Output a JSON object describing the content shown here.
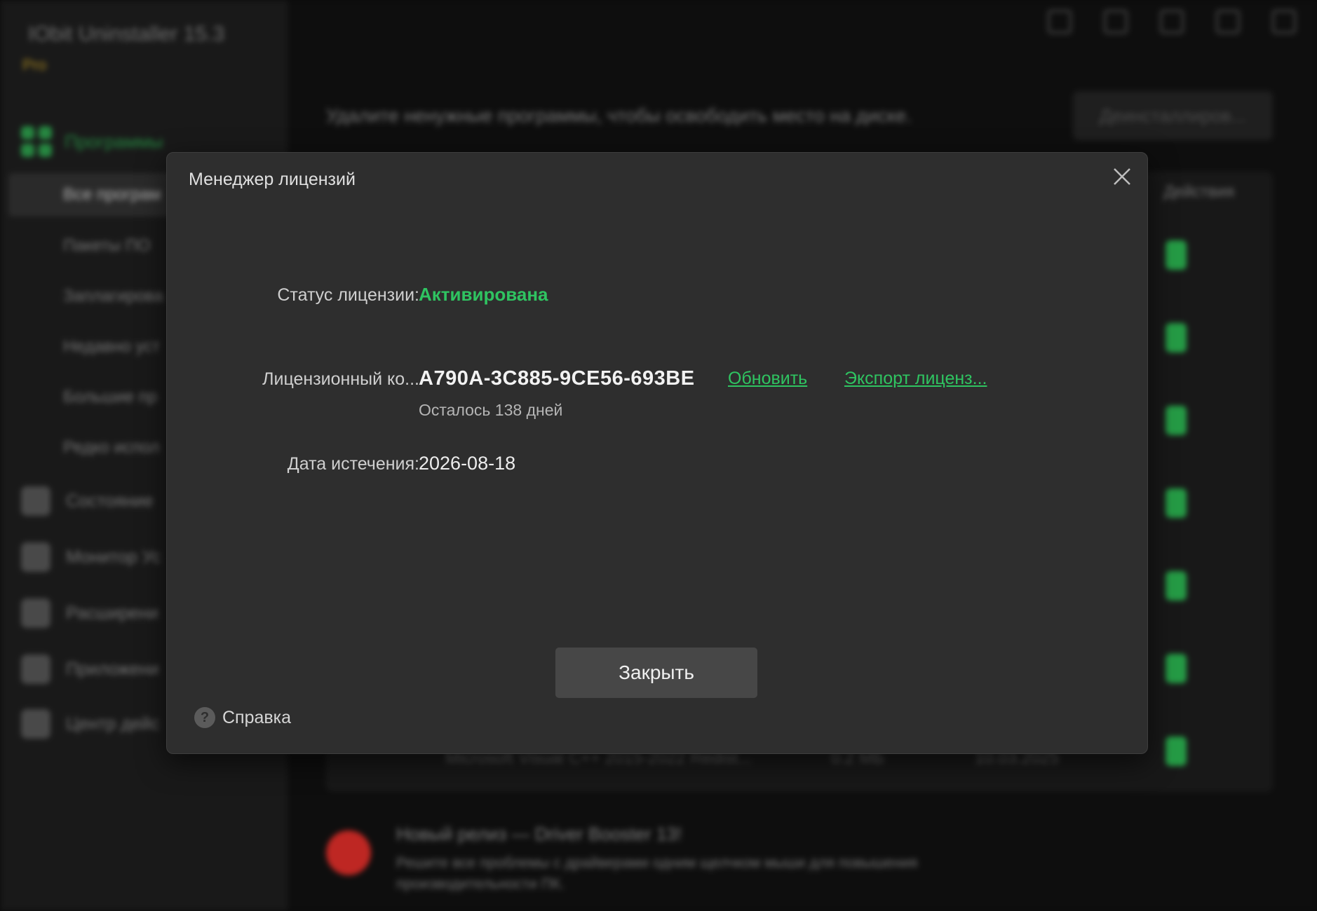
{
  "background_app": {
    "title": "IObit Uninstaller 15.3",
    "edition": "Pro",
    "nav_section": "Программы",
    "nav_items": [
      "Все програм",
      "Пакеты ПО",
      "Заплагирова",
      "Недавно уст",
      "Большие пр",
      "Редко испол"
    ],
    "tools": [
      "Состояние",
      "Монитор Ус",
      "Расширени",
      "Приложени",
      "Центр дейс"
    ],
    "subtitle": "Удалите ненужные программы, чтобы освободить место на диске.",
    "uninstall_button": "Деинсталлиров...",
    "table_header_actions": "Действия",
    "partial_row": {
      "name": "Microsoft Visual C++ 2015-2022 Redist...",
      "size": "0.2 МБ",
      "date": "10.03.2025"
    },
    "news": {
      "title": "Новый релиз — Driver Booster 13!",
      "description": "Решите все проблемы с драйверами одним щелчком мыши для повышения производительности ПК."
    }
  },
  "dialog": {
    "title": "Менеджер лицензий",
    "status_label": "Статус лицензии:",
    "status_value": "Активирована",
    "key_label": "Лицензионный ко...",
    "key_value": "A790A-3C885-9CE56-693BE",
    "update_link": "Обновить",
    "export_link": "Экспорт лиценз...",
    "remaining": "Осталось 138 дней",
    "expiry_label": "Дата истечения:",
    "expiry_value": "2026-08-18",
    "close_button": "Закрыть",
    "help_label": "Справка",
    "help_icon_glyph": "?"
  },
  "colors": {
    "accent_green": "#2fc461",
    "dialog_bg": "#2e2e2e",
    "button_bg": "#474747"
  }
}
